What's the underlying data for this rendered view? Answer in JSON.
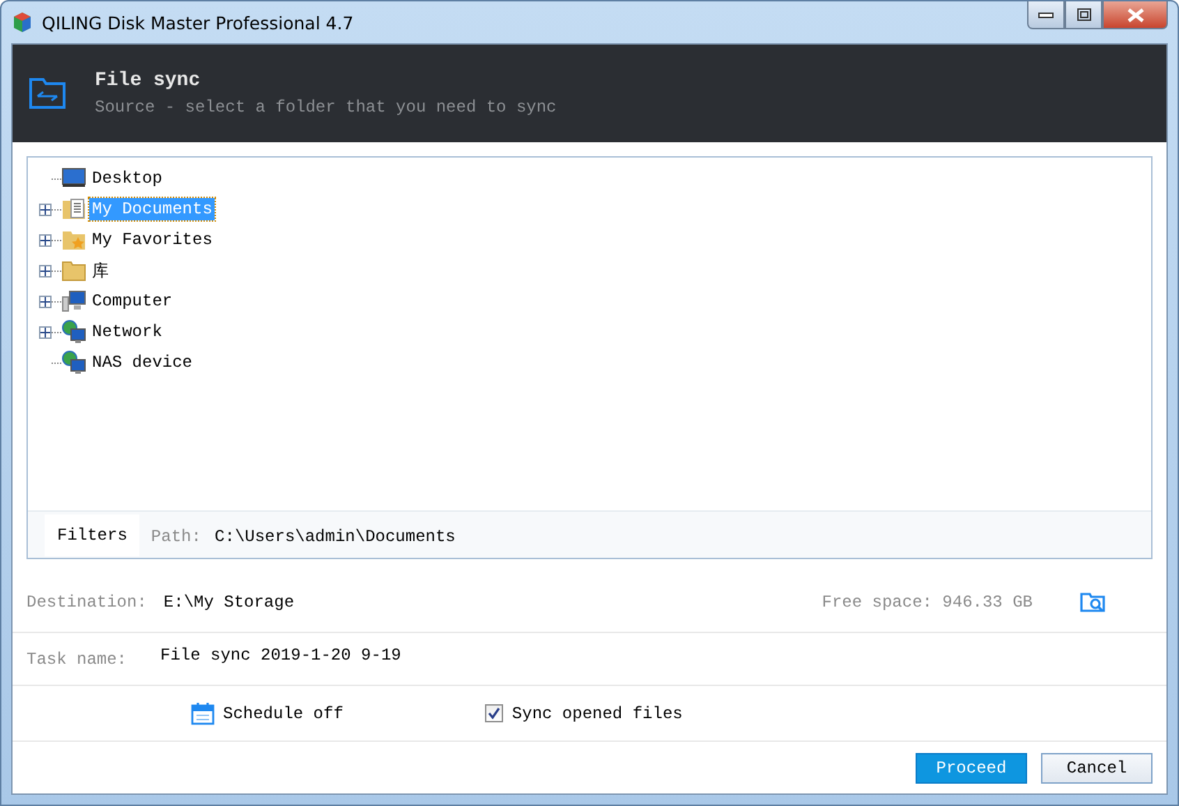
{
  "window": {
    "title": "QILING Disk Master Professional 4.7"
  },
  "header": {
    "title": "File sync",
    "subtitle": "Source - select a folder that you need to sync"
  },
  "tree": {
    "items": [
      {
        "label": "Desktop",
        "kind": "desktop",
        "expandable": false,
        "selected": false
      },
      {
        "label": "My Documents",
        "kind": "documents",
        "expandable": true,
        "selected": true
      },
      {
        "label": "My Favorites",
        "kind": "favorites",
        "expandable": true,
        "selected": false
      },
      {
        "label": "库",
        "kind": "folder",
        "expandable": true,
        "selected": false
      },
      {
        "label": "Computer",
        "kind": "computer",
        "expandable": true,
        "selected": false
      },
      {
        "label": "Network",
        "kind": "network",
        "expandable": true,
        "selected": false
      },
      {
        "label": "NAS device",
        "kind": "network",
        "expandable": false,
        "selected": false
      }
    ]
  },
  "filters_button": "Filters",
  "path": {
    "label": "Path:",
    "value": "C:\\Users\\admin\\Documents"
  },
  "destination": {
    "label": "Destination:",
    "value": "E:\\My Storage",
    "free_space": "Free space: 946.33 GB"
  },
  "task_name": {
    "label": "Task name:",
    "value": "File sync 2019-1-20 9-19"
  },
  "schedule": "Schedule off",
  "sync_opened_files": {
    "label": "Sync opened files",
    "checked": true
  },
  "buttons": {
    "proceed": "Proceed",
    "cancel": "Cancel"
  }
}
